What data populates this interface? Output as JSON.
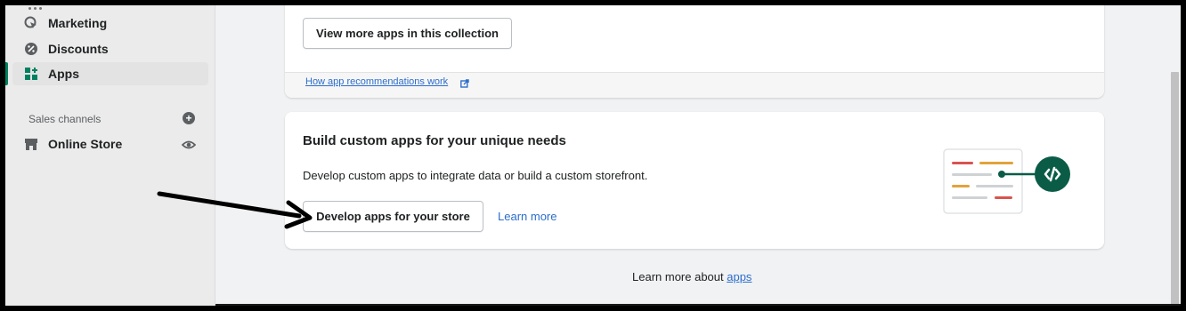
{
  "sidebar": {
    "items": [
      {
        "label": "Marketing",
        "icon": "marketing-icon"
      },
      {
        "label": "Discounts",
        "icon": "discount-icon"
      },
      {
        "label": "Apps",
        "icon": "apps-icon",
        "active": true
      }
    ],
    "sales_channels_label": "Sales channels",
    "channels": [
      {
        "label": "Online Store",
        "icon": "store-icon"
      }
    ]
  },
  "main": {
    "collection_button": "View more apps in this collection",
    "recommendations_link": "How app recommendations work",
    "custom_apps": {
      "title": "Build custom apps for your unique needs",
      "description": "Develop custom apps to integrate data or build a custom storefront.",
      "primary_button": "Develop apps for your store",
      "learn_more": "Learn more"
    },
    "footer_prefix": "Learn more about ",
    "footer_link": "apps"
  },
  "colors": {
    "accent": "#008060",
    "link": "#2c6ecb"
  }
}
